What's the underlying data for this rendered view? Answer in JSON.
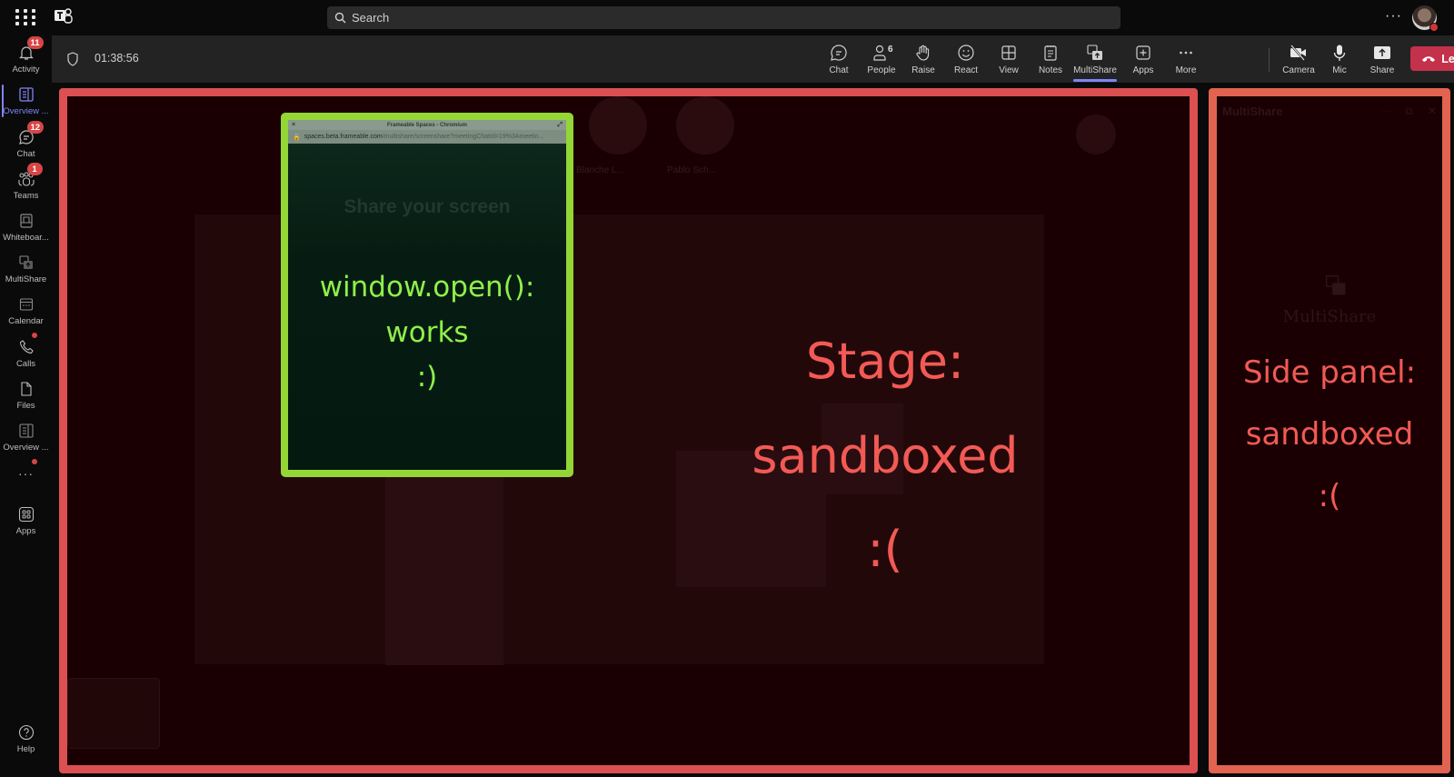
{
  "topbar": {
    "search_placeholder": "Search",
    "more_label": "···"
  },
  "rail": {
    "items": [
      {
        "label": "Activity",
        "badge": "11",
        "icon": "bell-icon"
      },
      {
        "label": "Overview ...",
        "icon": "document-icon",
        "active": true
      },
      {
        "label": "Chat",
        "badge": "12",
        "icon": "chat-icon"
      },
      {
        "label": "Teams",
        "badge": "1",
        "icon": "teams-icon"
      },
      {
        "label": "Whiteboar...",
        "icon": "whiteboard-icon"
      },
      {
        "label": "MultiShare",
        "icon": "multishare-icon"
      },
      {
        "label": "Calendar",
        "icon": "calendar-icon"
      },
      {
        "label": "Calls",
        "dot": true,
        "icon": "phone-icon"
      },
      {
        "label": "Files",
        "icon": "file-icon"
      },
      {
        "label": "Overview ...",
        "icon": "document-icon"
      },
      {
        "label": "···",
        "dot": true,
        "icon": "more-icon"
      },
      {
        "label": "Apps",
        "icon": "apps-icon"
      },
      {
        "label": "Help",
        "icon": "help-icon"
      }
    ]
  },
  "meeting": {
    "timer": "01:38:56",
    "toolbar": [
      {
        "label": "Chat",
        "icon": "chat-icon"
      },
      {
        "label": "People",
        "icon": "people-icon",
        "count": "6"
      },
      {
        "label": "Raise",
        "icon": "hand-icon"
      },
      {
        "label": "React",
        "icon": "smiley-icon"
      },
      {
        "label": "View",
        "icon": "grid-icon"
      },
      {
        "label": "Notes",
        "icon": "notes-icon"
      },
      {
        "label": "MultiShare",
        "icon": "multishare-icon",
        "active": true
      },
      {
        "label": "Apps",
        "icon": "add-app-icon"
      },
      {
        "label": "More",
        "icon": "more-icon"
      },
      {
        "label": "Camera",
        "icon": "camera-off-icon"
      },
      {
        "label": "Mic",
        "icon": "mic-icon"
      },
      {
        "label": "Share",
        "icon": "share-icon"
      }
    ],
    "leave_label": "Leave"
  },
  "stage": {
    "participants": [
      "Blanche L...",
      "Pablo Sch..."
    ],
    "annotation": [
      "Stage:",
      "sandboxed",
      ":("
    ],
    "annotation_color": "#f25a55",
    "border_color": "#dc5052"
  },
  "popup": {
    "window_title": "Frameable Spaces - Chromium",
    "url_host": "spaces.beta.frameable.com",
    "url_path": "/multishare/screenshare?meetingChatId=19%3Ameetin...",
    "heading": "Share your screen",
    "annotation": [
      "window.open():",
      "works",
      ":)"
    ],
    "annotation_color": "#8ff04a",
    "border_color": "#93d636"
  },
  "side_panel": {
    "title": "MultiShare",
    "empty_title": "MultiShare",
    "annotation": [
      "Side panel:",
      "sandboxed",
      ":("
    ],
    "border_color": "#e2634f"
  }
}
